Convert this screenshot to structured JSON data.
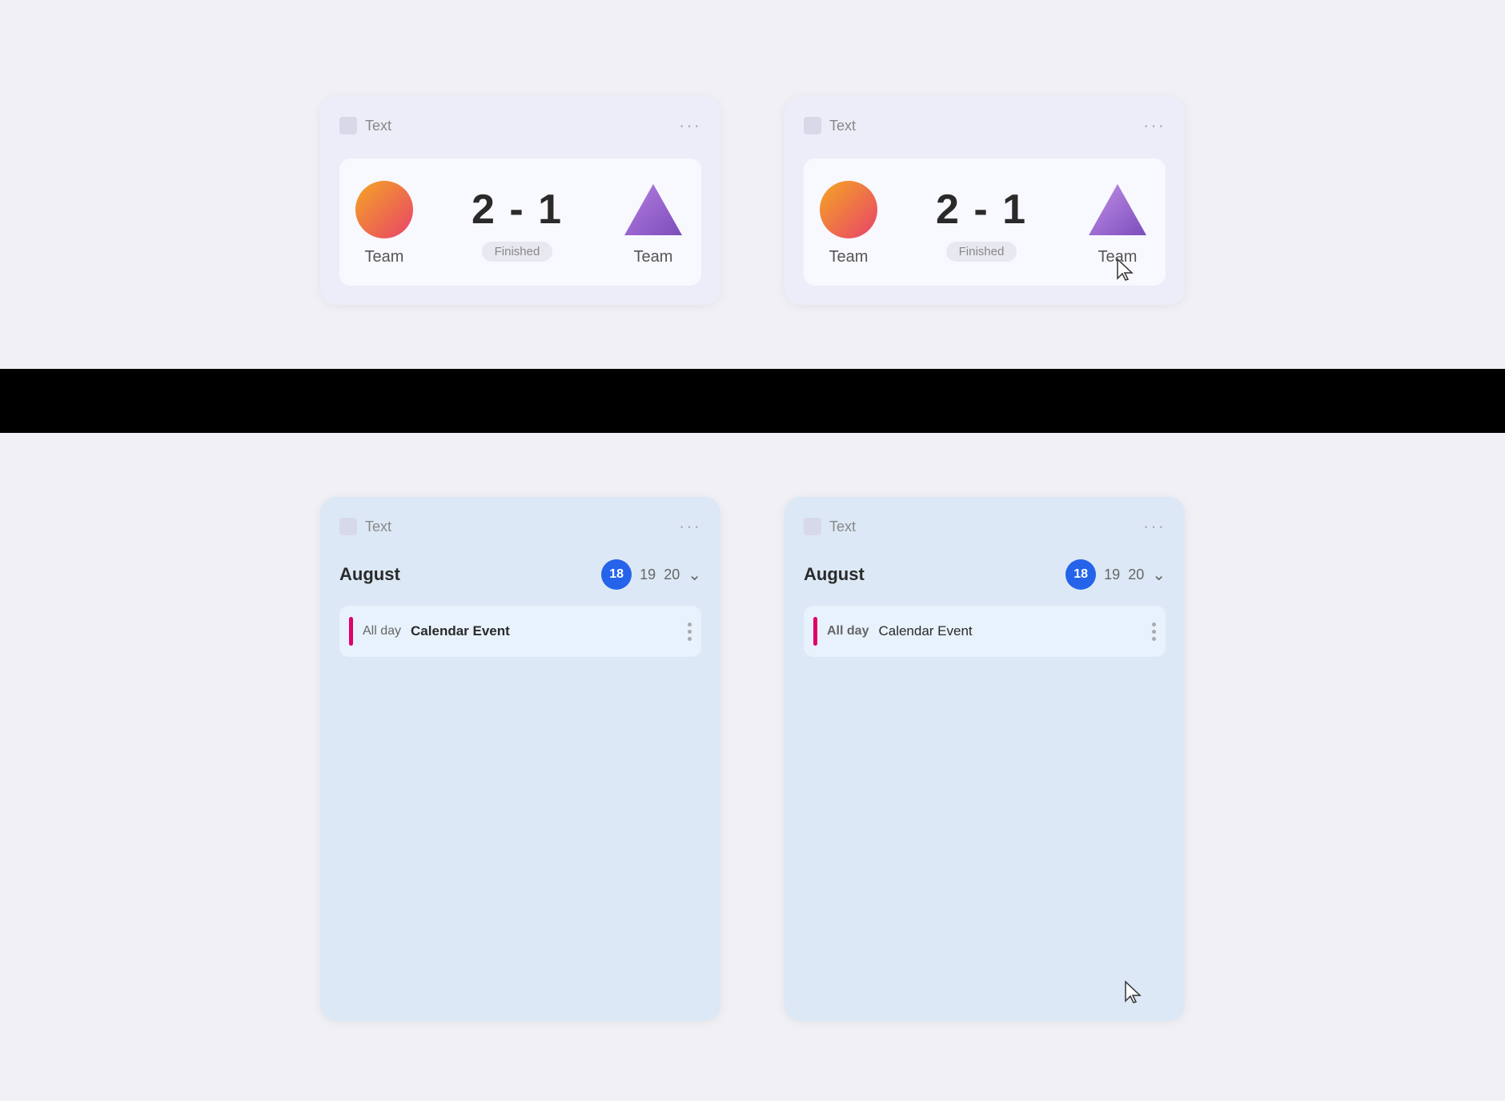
{
  "colors": {
    "accent_blue": "#2563eb",
    "event_bar": "#e0006a",
    "black_bar": "#000000",
    "card_bg_score": "#ecedf8",
    "card_bg_calendar": "#dce8f5",
    "score_inner_bg": "#f8f8ff",
    "team1_gradient_start": "#f5a623",
    "team1_gradient_end": "#e8426a",
    "team2_triangle": "#9b6dd1"
  },
  "top_left_card": {
    "header_text": "Text",
    "more_label": "···",
    "team1_name": "Team",
    "score": "2 - 1",
    "status": "Finished",
    "team2_name": "Team"
  },
  "top_right_card": {
    "header_text": "Text",
    "more_label": "···",
    "team1_name": "Team",
    "score": "2 - 1",
    "status": "Finished",
    "team2_name": "Team"
  },
  "bottom_left_card": {
    "header_text": "Text",
    "more_label": "···",
    "month": "August",
    "day_active": "18",
    "day2": "19",
    "day3": "20",
    "all_day_label": "All day",
    "event_title": "Calendar Event"
  },
  "bottom_right_card": {
    "header_text": "Text",
    "more_label": "···",
    "month": "August",
    "day_active": "18",
    "day2": "19",
    "day3": "20",
    "all_day_label": "All day",
    "event_title": "Calendar Event"
  }
}
